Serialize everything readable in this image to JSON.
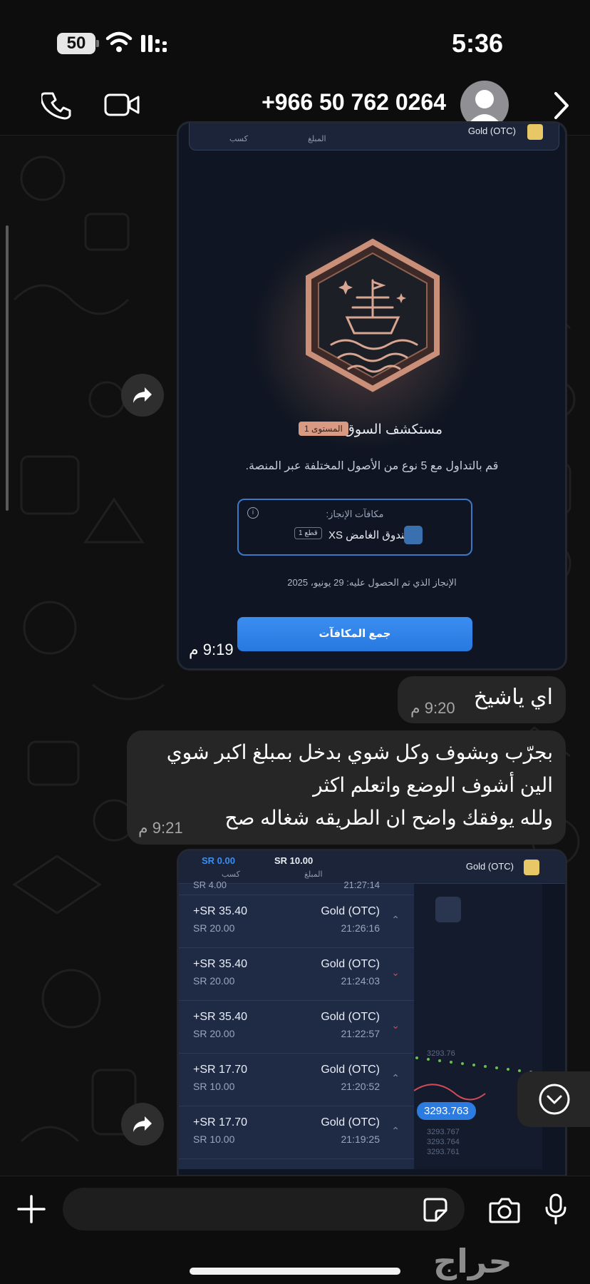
{
  "status_bar": {
    "battery": "50",
    "time": "5:36"
  },
  "header": {
    "contact": "+966 50 762 0264"
  },
  "messages": {
    "image1": {
      "topbar_asset": "Gold (OTC)",
      "topbar_amount_label": "المبلغ",
      "topbar_profit_label": "كسب",
      "rank_title": "مستكشف السوق",
      "level": "المستوى 1",
      "description": "قم بالتداول مع 5 نوع من الأصول المختلفة عبر المنصة.",
      "reward_label": "مكافآت الإنجاز:",
      "reward_item": "الصندوق الغامض XS",
      "reward_qty": "1 قطع",
      "achieved": "الإنجاز الذي تم الحصول عليه: 29 يونيو، 2025",
      "collect_button": "جمع المكافآت",
      "time": "9:19 م"
    },
    "reply1": {
      "text": "اي ياشيخ",
      "time": "9:20 م"
    },
    "reply2": {
      "line1": "بجرّب وبشوف وكل شوي بدخل بمبلغ اكبر شوي",
      "line2": "الين أشوف الوضع واتعلم اكثر",
      "line3": "ولله يوفقك واضح ان الطريقه شغاله صح",
      "time": "9:21 م"
    },
    "image2": {
      "profit_header": "SR 0.00",
      "profit_header_label": "كسب",
      "amount_header": "SR 10.00",
      "amount_header_label": "المبلغ",
      "asset_header": "Gold (OTC)",
      "partial_row_stake": "SR 4.00",
      "partial_row_time": "21:27:14",
      "rows": [
        {
          "profit": "+SR 35.40",
          "stake": "SR 20.00",
          "asset": "Gold (OTC)",
          "time": "21:26:16",
          "dir": "up"
        },
        {
          "profit": "+SR 35.40",
          "stake": "SR 20.00",
          "asset": "Gold (OTC)",
          "time": "21:24:03",
          "dir": "down"
        },
        {
          "profit": "+SR 35.40",
          "stake": "SR 20.00",
          "asset": "Gold (OTC)",
          "time": "21:22:57",
          "dir": "down"
        },
        {
          "profit": "+SR 17.70",
          "stake": "SR 10.00",
          "asset": "Gold (OTC)",
          "time": "21:20:52",
          "dir": "up"
        },
        {
          "profit": "+SR 17.70",
          "stake": "SR 10.00",
          "asset": "Gold (OTC)",
          "time": "21:19:25",
          "dir": "up"
        }
      ],
      "price_tag": "3293.763",
      "price_ticks": [
        "3293.76",
        "3293.767",
        "3293.764",
        "3293.761"
      ]
    }
  },
  "watermark": "حراج",
  "colors": {
    "accent_blue": "#3b8ef0",
    "bubble": "#262626",
    "up_arrow": "#7f8aa3",
    "down_arrow": "#d04a5a"
  }
}
